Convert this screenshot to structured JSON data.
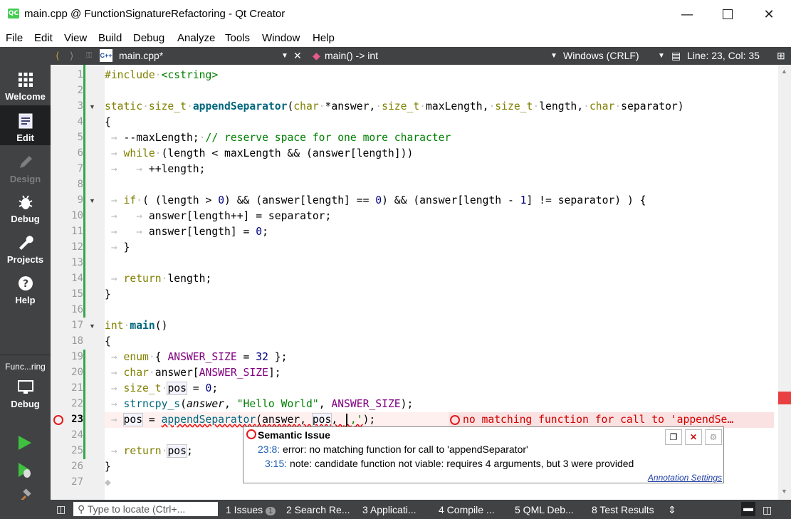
{
  "window": {
    "title": "main.cpp @ FunctionSignatureRefactoring - Qt Creator",
    "app_icon": "QC"
  },
  "menu": [
    "File",
    "Edit",
    "View",
    "Build",
    "Debug",
    "Analyze",
    "Tools",
    "Window",
    "Help"
  ],
  "modes": {
    "welcome": "Welcome",
    "edit": "Edit",
    "design": "Design",
    "debug": "Debug",
    "projects": "Projects",
    "help": "Help",
    "project_name": "Func...ring",
    "kit": "Debug"
  },
  "toolbar": {
    "file": "main.cpp*",
    "symbol": "main() -> int",
    "line_endings": "Windows (CRLF)",
    "position": "Line: 23, Col: 35"
  },
  "lines": [
    "1",
    "2",
    "3",
    "4",
    "5",
    "6",
    "7",
    "8",
    "9",
    "10",
    "11",
    "12",
    "13",
    "14",
    "15",
    "16",
    "17",
    "18",
    "19",
    "20",
    "21",
    "22",
    "23",
    "24",
    "25",
    "26",
    "27"
  ],
  "code": {
    "l1a": "#include",
    "l1b": "<cstring>",
    "l3a": "static",
    "l3b": "size_t",
    "l3c": "appendSeparator",
    "l3d": "(",
    "l3e": "char",
    "l3f": "*answer,",
    "l3g": "size_t",
    "l3h": "maxLength,",
    "l3i": "size_t",
    "l3j": "length,",
    "l3k": "char",
    "l3l": "separator)",
    "l4": "{",
    "l5a": "--maxLength;",
    "l5b": "// reserve space for one more character",
    "l6a": "while",
    "l6b": "(length < maxLength && (answer[length]))",
    "l7": "++length;",
    "l9a": "if",
    "l9b": "( (length > ",
    "l9c": "0",
    "l9d": ") && (answer[length] == ",
    "l9e": "0",
    "l9f": ") && (answer[length - ",
    "l9g": "1",
    "l9h": "] != separator) ) {",
    "l10": "answer[length++] = separator;",
    "l11a": "answer[length] = ",
    "l11b": "0",
    "l11c": ";",
    "l12": "}",
    "l14a": "return",
    "l14b": "length;",
    "l15": "}",
    "l17a": "int",
    "l17b": "main",
    "l17c": "()",
    "l18": "{",
    "l19a": "enum",
    "l19b": "{ ",
    "l19c": "ANSWER_SIZE",
    "l19d": " = ",
    "l19e": "32",
    "l19f": " };",
    "l20a": "char",
    "l20b": "answer[",
    "l20c": "ANSWER_SIZE",
    "l20d": "];",
    "l21a": "size_t",
    "l21b": "pos",
    "l21c": " = ",
    "l21d": "0",
    "l21e": ";",
    "l22a": "strncpy_s",
    "l22b": "(",
    "l22c": "answer",
    "l22d": ", ",
    "l22e": "\"Hello World\"",
    "l22f": ", ",
    "l22g": "ANSWER_SIZE",
    "l22h": ");",
    "l23a": "pos",
    "l23b": " = ",
    "l23c": "appendSeparator",
    "l23d": "(answer, ",
    "l23e": "pos",
    "l23f": ", ",
    "l23g": "','",
    "l23h": ");",
    "l25a": "return",
    "l25b": "pos",
    "l25c": ";",
    "l26": "}"
  },
  "inline_error": "no matching function for call to 'appendSe…",
  "tooltip": {
    "title": "Semantic Issue",
    "line1_loc": "23:8:",
    "line1_msg": "error: no matching function for call to 'appendSeparator'",
    "line2_loc": "3:15:",
    "line2_msg": "note: candidate function not viable: requires 4 arguments, but 3 were provided",
    "link": "Annotation Settings"
  },
  "status": {
    "locate_placeholder": "Type to locate (Ctrl+...",
    "panes": [
      "1 Issues",
      "2 Search Re...",
      "3 Applicati...",
      "4 Compile ...",
      "5 QML Deb...",
      "8 Test Results"
    ],
    "issues_count": "1"
  },
  "colors": {
    "sidebar": "#404244",
    "keyword": "#808000",
    "function": "#00677c",
    "string": "#008000",
    "enum": "#800080",
    "error": "#e31a1a",
    "change_bar": "#32a84b"
  }
}
